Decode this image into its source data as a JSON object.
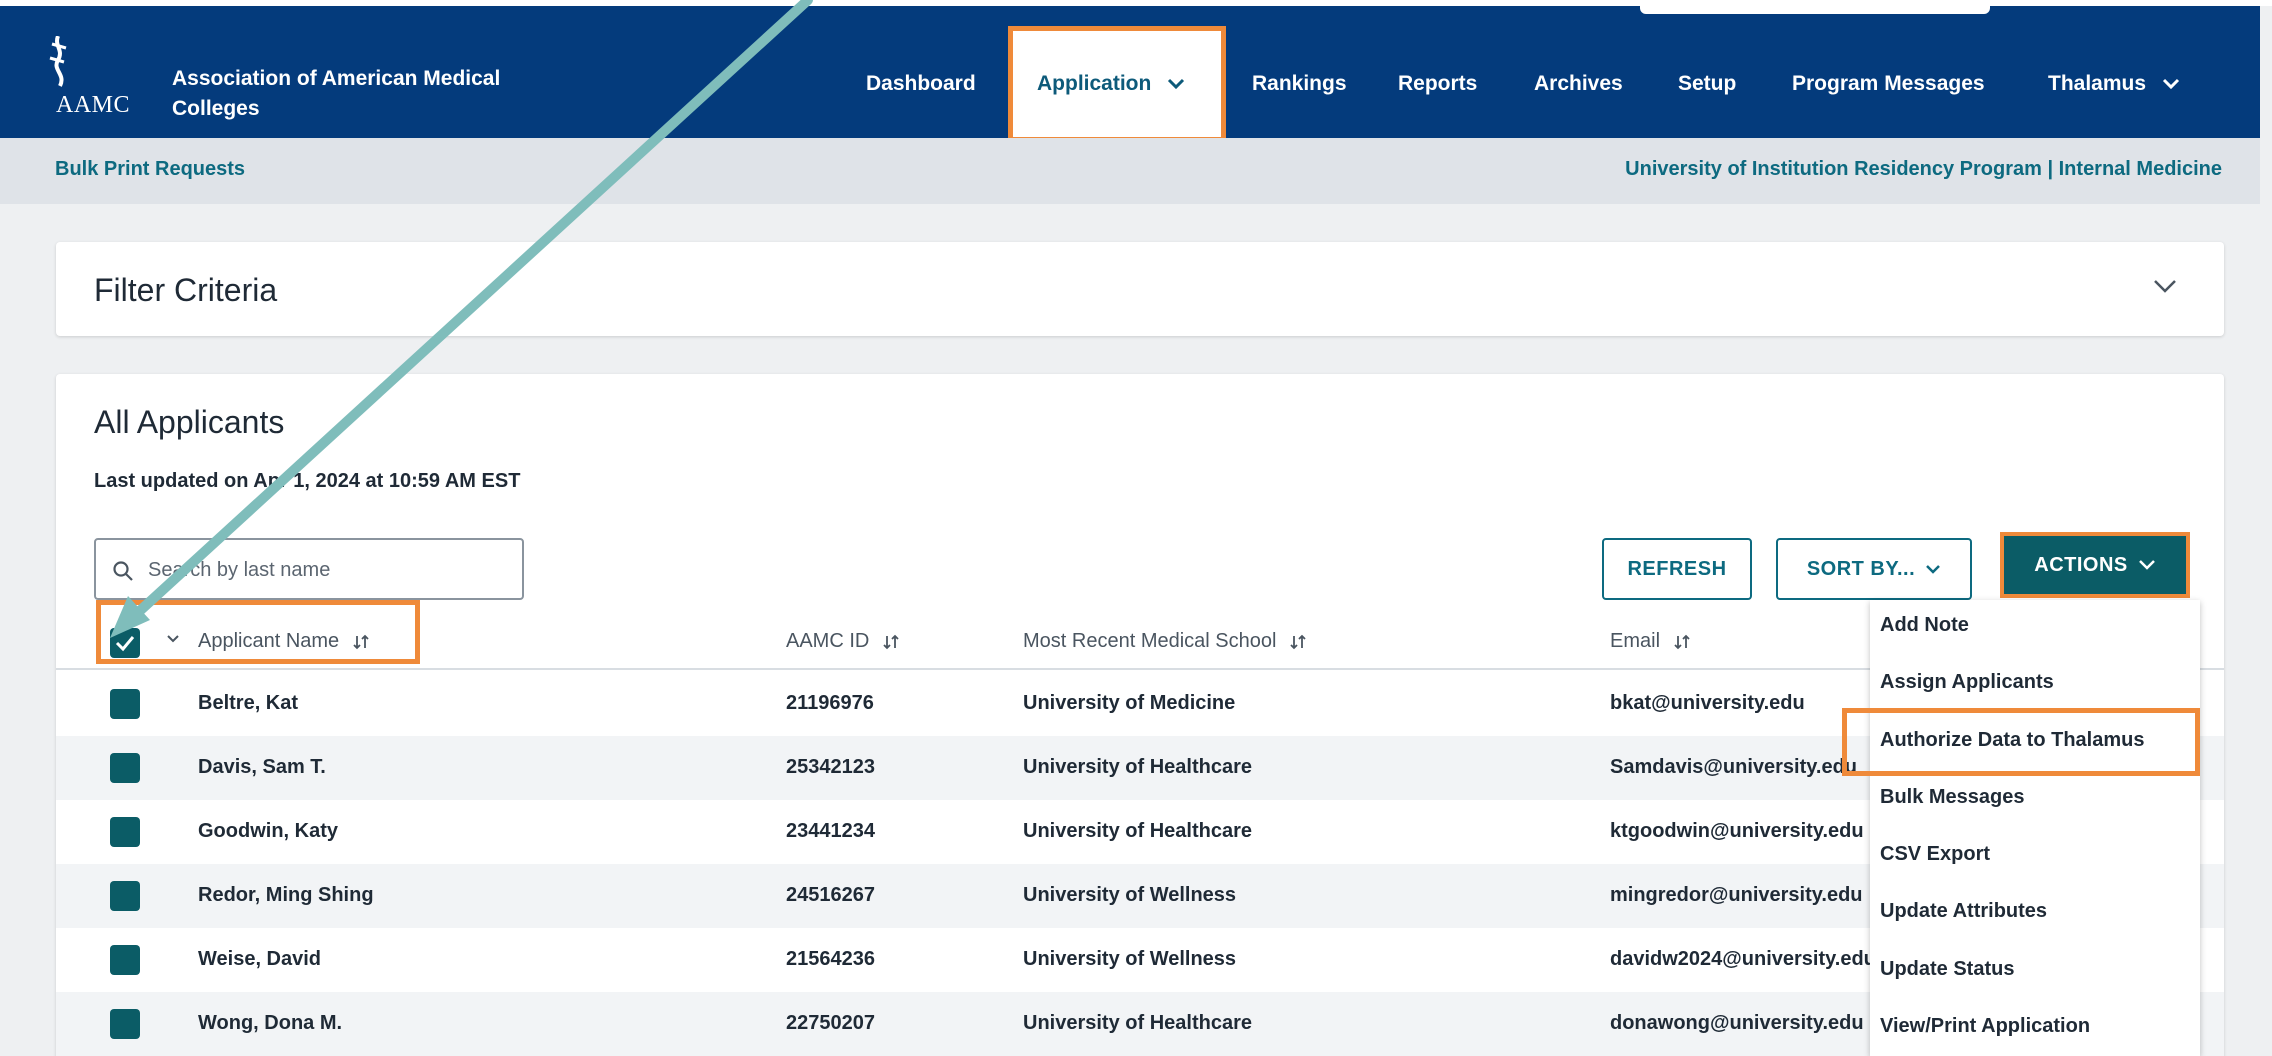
{
  "header": {
    "logo_text": "AAMC",
    "org_name": "Association of American Medical Colleges",
    "nav": [
      {
        "label": "Dashboard"
      },
      {
        "label": "Application"
      },
      {
        "label": "Rankings"
      },
      {
        "label": "Reports"
      },
      {
        "label": "Archives"
      },
      {
        "label": "Setup"
      },
      {
        "label": "Program Messages"
      },
      {
        "label": "Thalamus"
      }
    ]
  },
  "breadcrumb": {
    "left": "Bulk Print Requests",
    "right": "University of Institution Residency Program | Internal Medicine"
  },
  "filter": {
    "title": "Filter Criteria"
  },
  "applicants": {
    "title": "All Applicants",
    "last_updated": "Last updated on Apr 1, 2024 at 10:59 AM EST",
    "search_placeholder": "Search by last name",
    "refresh_label": "REFRESH",
    "sort_label": "SORT BY...",
    "actions_label": "ACTIONS",
    "columns": {
      "name": "Applicant Name",
      "id": "AAMC ID",
      "school": "Most Recent Medical School",
      "email": "Email"
    },
    "rows": [
      {
        "name": "Beltre, Kat",
        "id": "21196976",
        "school": "University of Medicine",
        "email": "bkat@university.edu"
      },
      {
        "name": "Davis, Sam T.",
        "id": "25342123",
        "school": "University of Healthcare",
        "email": "Samdavis@university.edu"
      },
      {
        "name": "Goodwin, Katy",
        "id": "23441234",
        "school": "University of Healthcare",
        "email": "ktgoodwin@university.edu"
      },
      {
        "name": "Redor, Ming Shing",
        "id": "24516267",
        "school": "University of Wellness",
        "email": "mingredor@university.edu"
      },
      {
        "name": "Weise, David",
        "id": "21564236",
        "school": "University of Wellness",
        "email": "davidw2024@university.edu"
      },
      {
        "name": "Wong, Dona M.",
        "id": "22750207",
        "school": "University of Healthcare",
        "email": "donawong@university.edu"
      }
    ]
  },
  "actions_menu": {
    "items": [
      {
        "label": "Add Note"
      },
      {
        "label": "Assign Applicants"
      },
      {
        "label": "Authorize Data to Thalamus"
      },
      {
        "label": "Bulk Messages"
      },
      {
        "label": "CSV Export"
      },
      {
        "label": "Update Attributes"
      },
      {
        "label": "Update Status"
      },
      {
        "label": "View/Print Application"
      }
    ]
  },
  "colors": {
    "nav_bg": "#043b7c",
    "accent_teal": "#0b5c66",
    "link_teal": "#0d6a80",
    "highlight_orange": "#ef8a3a",
    "arrow_teal": "#7fbdbb"
  },
  "icons": {
    "logo": "caduceus-icon",
    "nav_dropdown": "chevron-down-icon",
    "search": "search-icon",
    "sort": "sort-arrows-icon",
    "checkbox": "checkmark-icon"
  }
}
